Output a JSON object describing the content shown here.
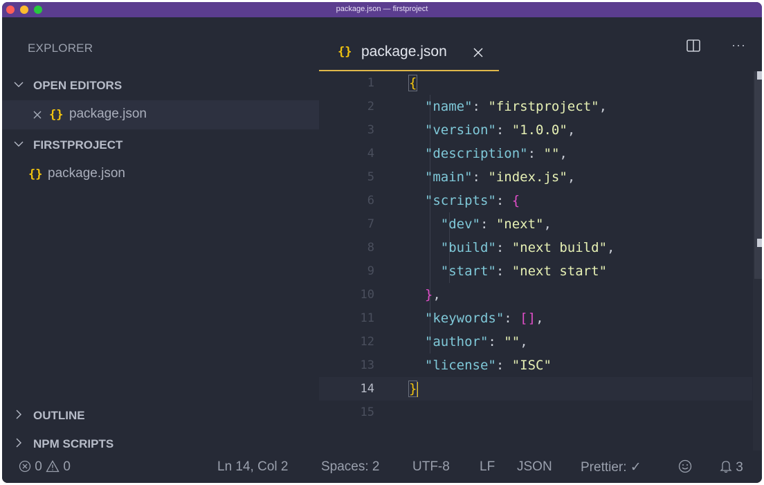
{
  "window": {
    "title": "package.json — firstproject"
  },
  "sidebar": {
    "explorer_title": "EXPLORER",
    "sections": {
      "open_editors": "OPEN EDITORS",
      "project": "FIRSTPROJECT",
      "outline": "OUTLINE",
      "npm_scripts": "NPM SCRIPTS"
    },
    "open_file": {
      "icon": "{}",
      "name": "package.json"
    },
    "project_file": {
      "icon": "{}",
      "name": "package.json"
    }
  },
  "editor": {
    "tab": {
      "icon": "{}",
      "name": "package.json"
    },
    "more_label": "···",
    "current_line": 14,
    "line_numbers": [
      "1",
      "2",
      "3",
      "4",
      "5",
      "6",
      "7",
      "8",
      "9",
      "10",
      "11",
      "12",
      "13",
      "14",
      "15"
    ],
    "code": {
      "l1": "{",
      "l2": {
        "key": "\"name\"",
        "value": "\"firstproject\""
      },
      "l3": {
        "key": "\"version\"",
        "value": "\"1.0.0\""
      },
      "l4": {
        "key": "\"description\"",
        "value": "\"\""
      },
      "l5": {
        "key": "\"main\"",
        "value": "\"index.js\""
      },
      "l6": {
        "key": "\"scripts\"",
        "open": "{"
      },
      "l7": {
        "key": "\"dev\"",
        "value": "\"next\""
      },
      "l8": {
        "key": "\"build\"",
        "value": "\"next build\""
      },
      "l9": {
        "key": "\"start\"",
        "value": "\"next start\""
      },
      "l10": "}",
      "l11": {
        "key": "\"keywords\"",
        "value": "[]"
      },
      "l12": {
        "key": "\"author\"",
        "value": "\"\""
      },
      "l13": {
        "key": "\"license\"",
        "value": "\"ISC\""
      },
      "l14": "}"
    }
  },
  "statusbar": {
    "errors": "0",
    "warnings": "0",
    "position": "Ln 14, Col 2",
    "spaces": "Spaces: 2",
    "encoding": "UTF-8",
    "eol": "LF",
    "language": "JSON",
    "prettier": "Prettier: ✓",
    "notifications": "3"
  },
  "colors": {
    "accent_tab": "#e0b84a",
    "braces_icon": "#f1c40f",
    "titlebar": "#5b3d8f",
    "json_key": "#7fc8d8",
    "json_string": "#e6f0b4",
    "bracket_magenta": "#e04ec8"
  },
  "icons": {
    "traffic_lights": [
      "close-traffic-light-icon",
      "minimize-traffic-light-icon",
      "maximize-traffic-light-icon"
    ],
    "chevron_down": "chevron-down-icon",
    "chevron_right": "chevron-right-icon",
    "close": "close-icon",
    "split_editor": "split-editor-icon",
    "error": "error-circle-icon",
    "warning": "warning-triangle-icon",
    "feedback": "smiley-icon",
    "bell": "bell-icon"
  }
}
